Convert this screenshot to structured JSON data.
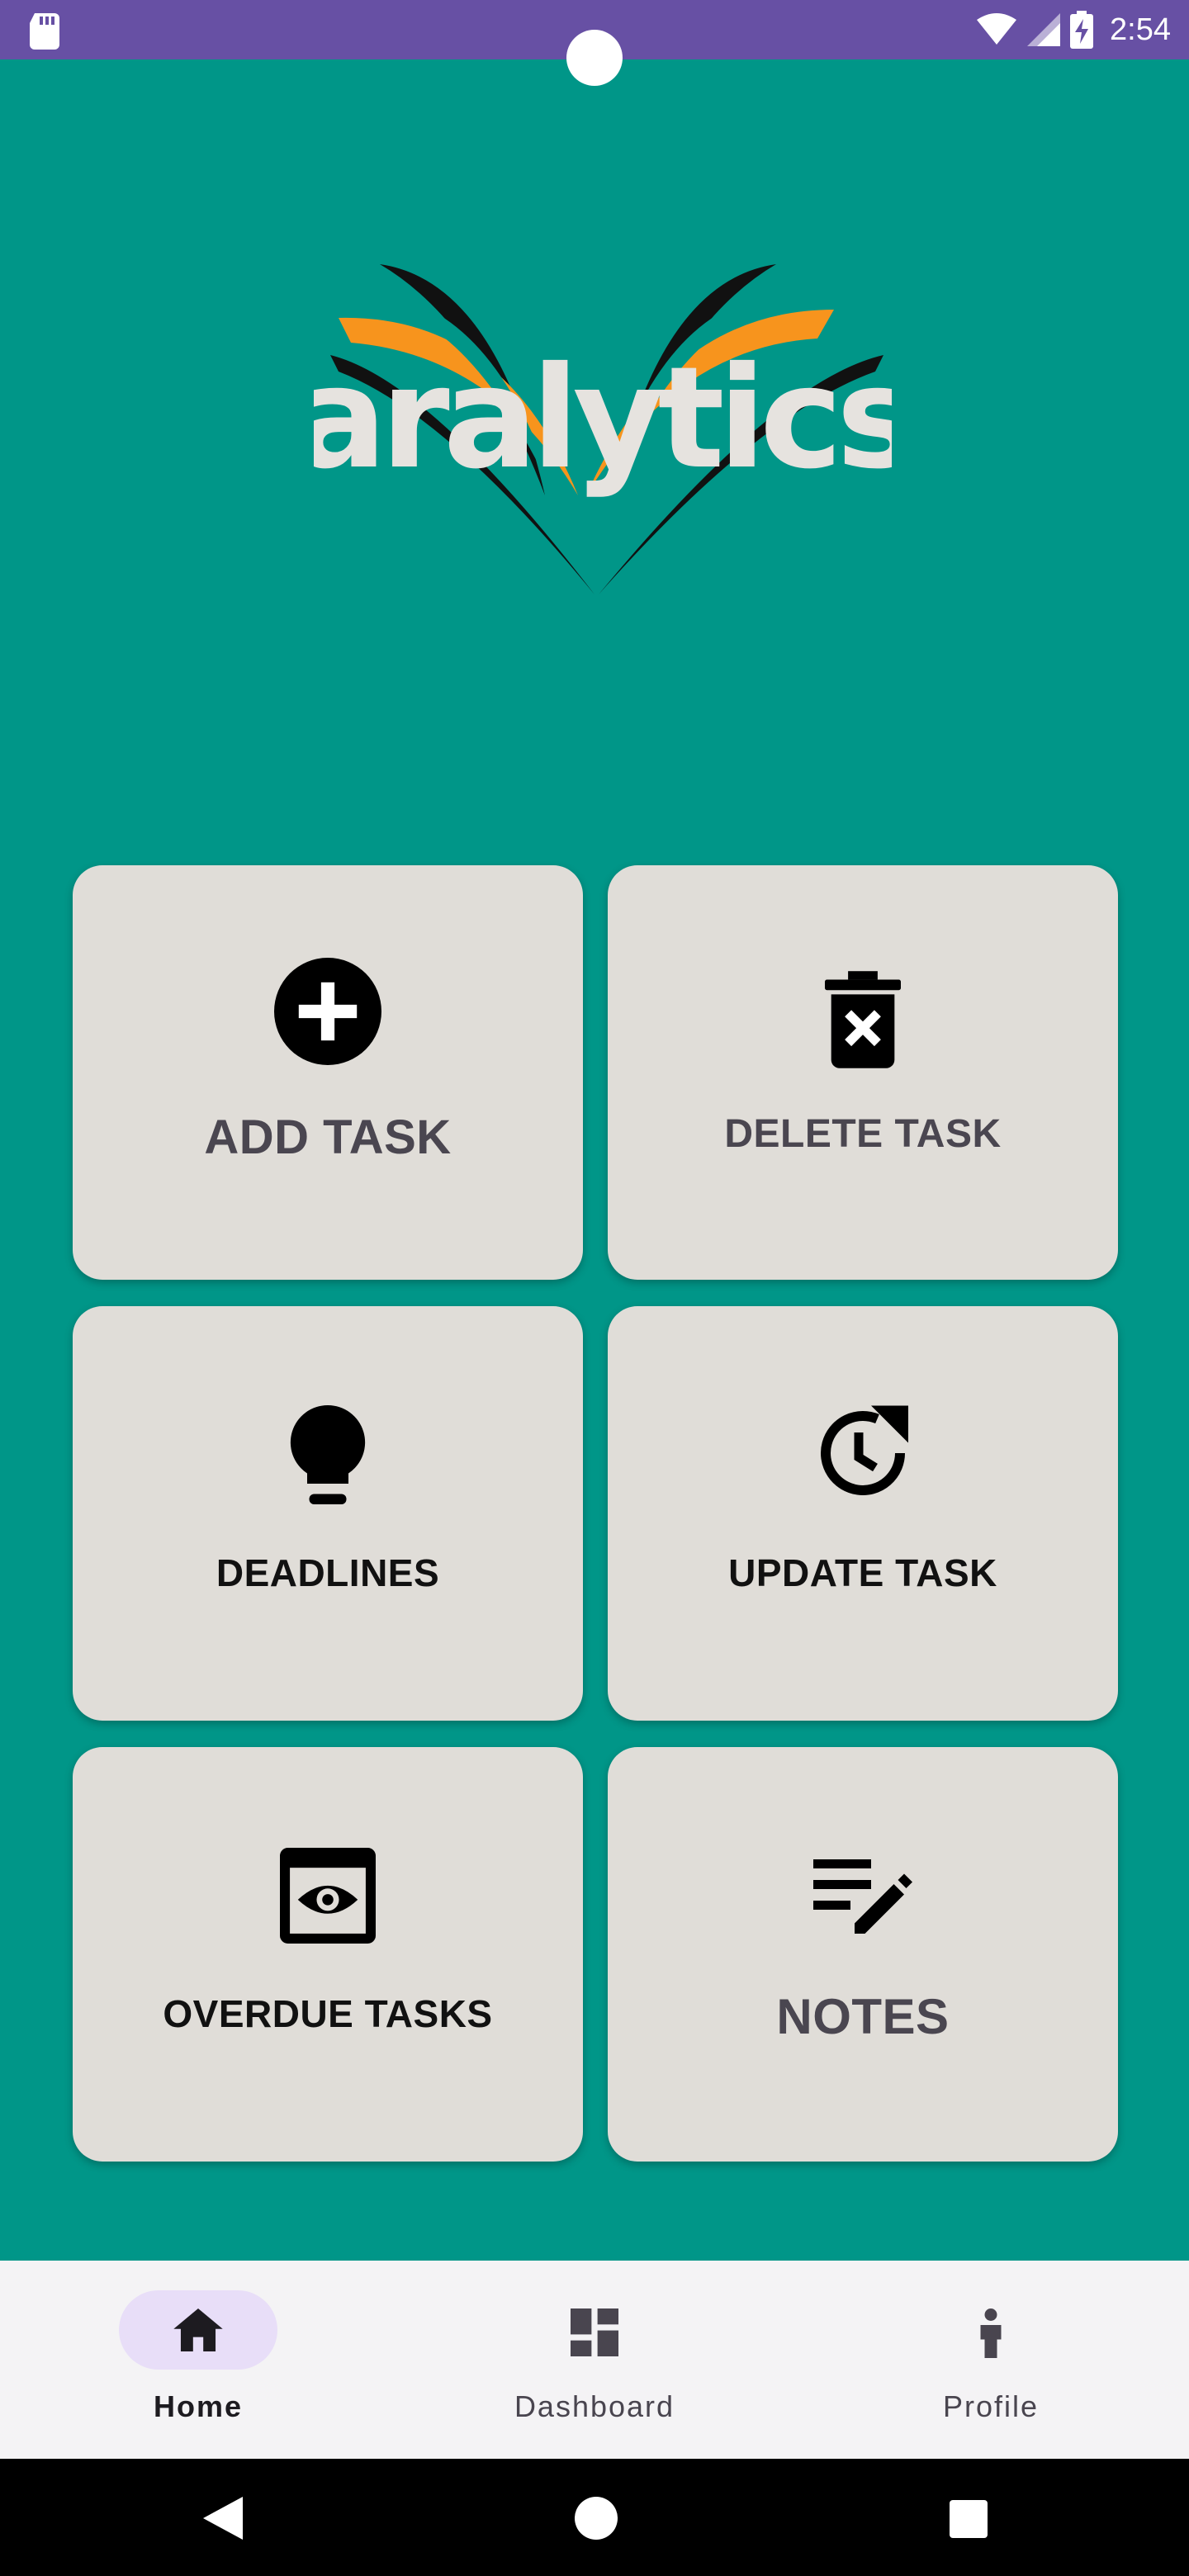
{
  "status_bar": {
    "time": "2:54"
  },
  "logo": {
    "text": "aralytics",
    "colors": {
      "teal": "#009688",
      "orange": "#f7941d",
      "black": "#111111",
      "white": "#e6e3df"
    }
  },
  "cards": {
    "add_task": {
      "label": "ADD TASK",
      "icon": "add-circle-icon"
    },
    "delete_task": {
      "label": "DELETE TASK",
      "icon": "delete-icon"
    },
    "deadlines": {
      "label": "DEADLINES",
      "icon": "lightbulb-icon"
    },
    "update_task": {
      "label": "UPDATE TASK",
      "icon": "update-clock-icon"
    },
    "overdue_tasks": {
      "label": "OVERDUE TASKS",
      "icon": "preview-eye-icon"
    },
    "notes": {
      "label": "NOTES",
      "icon": "edit-note-icon"
    }
  },
  "bottom_nav": {
    "home": {
      "label": "Home",
      "icon": "home-icon",
      "selected": true
    },
    "dashboard": {
      "label": "Dashboard",
      "icon": "dashboard-icon"
    },
    "profile": {
      "label": "Profile",
      "icon": "person-icon"
    }
  },
  "colors": {
    "background": "#009688",
    "status_bar": "#6750a4",
    "card": "#e0ddd8",
    "nav_pill": "#e8def8"
  }
}
